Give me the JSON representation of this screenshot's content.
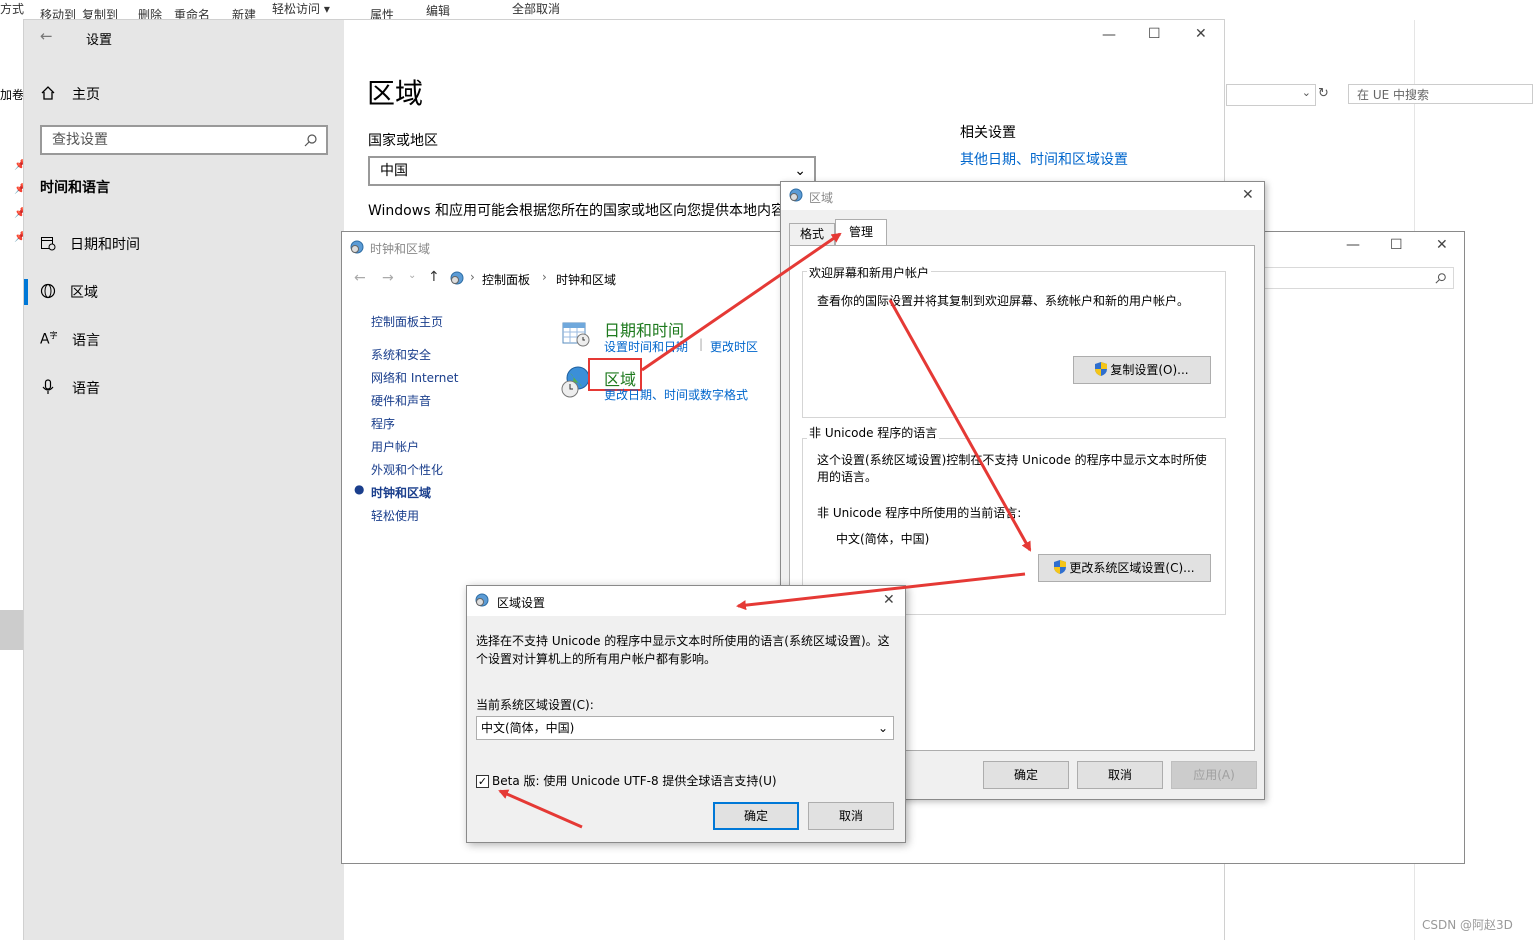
{
  "background_explorer": {
    "ribbon_items": [
      "方式",
      "移动到",
      "复制到",
      "删除",
      "重命名",
      "新建",
      "轻松访问 ▾",
      "属性",
      "编辑",
      "全部取消"
    ],
    "left_label": "加卷",
    "search_placeholder": "在 UE 中搜索"
  },
  "settings": {
    "title": "设置",
    "home": "主页",
    "search_placeholder": "查找设置",
    "section": "时间和语言",
    "nav": [
      "日期和时间",
      "区域",
      "语言",
      "语音"
    ],
    "page_title": "区域",
    "country_label": "国家或地区",
    "country_value": "中国",
    "country_desc": "Windows 和应用可能会根据您所在的国家或地区向您提供本地内容",
    "related_title": "相关设置",
    "related_link": "其他日期、时间和区域设置"
  },
  "control_panel": {
    "title": "时钟和区域",
    "breadcrumb": [
      "控制面板",
      "时钟和区域"
    ],
    "sidebar_home": "控制面板主页",
    "sidebar_items": [
      "系统和安全",
      "网络和 Internet",
      "硬件和声音",
      "程序",
      "用户帐户",
      "外观和个性化",
      "时钟和区域",
      "轻松使用"
    ],
    "datetime_title": "日期和时间",
    "datetime_links": [
      "设置时间和日期",
      "更改时区"
    ],
    "region_title": "区域",
    "region_link": "更改日期、时间或数字格式"
  },
  "region_dialog": {
    "title": "区域",
    "tabs": [
      "格式",
      "管理"
    ],
    "welcome_group": "欢迎屏幕和新用户帐户",
    "welcome_desc": "查看你的国际设置并将其复制到欢迎屏幕、系统帐户和新的用户帐户。",
    "copy_button": "复制设置(O)...",
    "unicode_group": "非 Unicode 程序的语言",
    "unicode_desc_line1": "这个设置(系统区域设置)控制在不支持 Unicode 的程序中显示文本时所使",
    "unicode_desc_line2": "用的语言。",
    "current_label": "非 Unicode 程序中所使用的当前语言:",
    "current_value": "中文(简体，中国)",
    "change_button": "更改系统区域设置(C)...",
    "ok": "确定",
    "cancel": "取消",
    "apply": "应用(A)"
  },
  "locale_dialog": {
    "title": "区域设置",
    "desc_line1": "选择在不支持 Unicode 的程序中显示文本时所使用的语言(系统区域设置)。这",
    "desc_line2": "个设置对计算机上的所有用户帐户都有影响。",
    "current_label": "当前系统区域设置(C):",
    "current_value": "中文(简体，中国)",
    "beta_label": "Beta 版: 使用 Unicode UTF-8 提供全球语言支持(U)",
    "beta_checked": true,
    "ok": "确定",
    "cancel": "取消"
  },
  "watermark": "CSDN @阿赵3D",
  "colors": {
    "accent": "#0078d7",
    "annotation_red": "#e53935",
    "link": "#0066cc",
    "green": "#1e7a1e"
  }
}
